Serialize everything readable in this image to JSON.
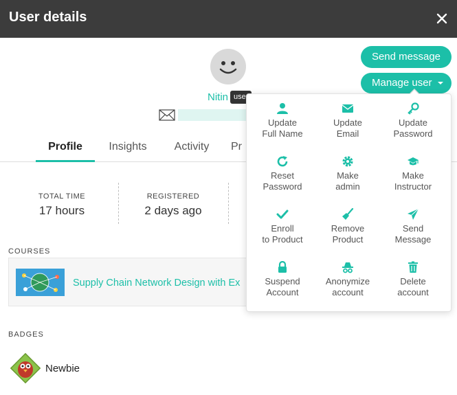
{
  "header": {
    "title": "User details"
  },
  "user": {
    "name": "Nitin",
    "role": "user"
  },
  "actions": {
    "send_message": "Send message",
    "manage_user": "Manage user"
  },
  "tabs": [
    {
      "label": "Profile"
    },
    {
      "label": "Insights"
    },
    {
      "label": "Activity"
    },
    {
      "label": "Pr"
    }
  ],
  "stats": [
    {
      "label": "TOTAL TIME",
      "value": "17 hours"
    },
    {
      "label": "REGISTERED",
      "value": "2 days ago"
    }
  ],
  "courses": {
    "label": "COURSES",
    "items": [
      {
        "title": "Supply Chain Network Design with Ex"
      }
    ]
  },
  "badges": {
    "label": "BADGES",
    "items": [
      {
        "name": "Newbie"
      }
    ]
  },
  "manage_menu": {
    "items": [
      {
        "label": "Update\nFull Name",
        "icon": "user-icon"
      },
      {
        "label": "Update\nEmail",
        "icon": "envelope-icon"
      },
      {
        "label": "Update\nPassword",
        "icon": "key-icon"
      },
      {
        "label": "Reset\nPassword",
        "icon": "refresh-icon"
      },
      {
        "label": "Make\nadmin",
        "icon": "gear-icon"
      },
      {
        "label": "Make\nInstructor",
        "icon": "graduation-cap-icon"
      },
      {
        "label": "Enroll\nto Product",
        "icon": "checkmark-icon"
      },
      {
        "label": "Remove\nProduct",
        "icon": "broom-icon"
      },
      {
        "label": "Send\nMessage",
        "icon": "paper-plane-icon"
      },
      {
        "label": "Suspend\nAccount",
        "icon": "lock-icon"
      },
      {
        "label": "Anonymize\naccount",
        "icon": "incognito-icon"
      },
      {
        "label": "Delete\naccount",
        "icon": "trash-icon"
      }
    ]
  },
  "colors": {
    "accent": "#1cbfa8",
    "header_bg": "#3c3c3c"
  }
}
